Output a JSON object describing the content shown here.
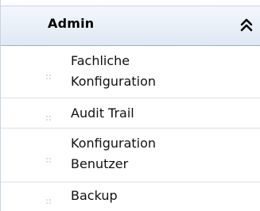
{
  "section": {
    "title": "Admin",
    "collapse_icon": "double-chevron-up-icon"
  },
  "items": [
    {
      "label": "Fachliche\nKonfiguration",
      "icon": "grip-dots-icon"
    },
    {
      "label": "Audit Trail",
      "icon": "grip-dots-icon"
    },
    {
      "label": "Konfiguration\nBenutzer",
      "icon": "grip-dots-icon"
    },
    {
      "label": "Backup",
      "icon": "grip-dots-icon"
    }
  ],
  "colors": {
    "header_bg": "#e9f0f8",
    "border": "#c9d3e0",
    "bullet": "#d9e2ec"
  }
}
